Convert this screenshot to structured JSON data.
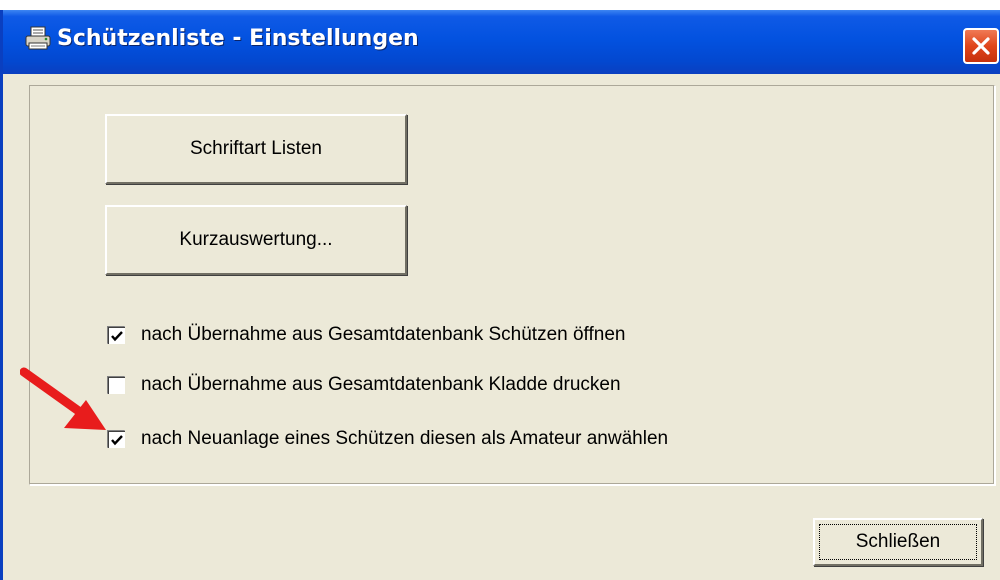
{
  "window": {
    "title": "Schützenliste - Einstellungen",
    "app_icon": "printer-icon",
    "close_icon": "close-icon"
  },
  "buttons": {
    "schriftart_label": "Schriftart Listen",
    "kurzauswertung_label": "Kurzauswertung...",
    "close_label": "Schließen"
  },
  "checkboxes": [
    {
      "label": "nach Übernahme aus Gesamtdatenbank Schützen öffnen",
      "checked": true
    },
    {
      "label": "nach Übernahme aus Gesamtdatenbank Kladde drucken",
      "checked": false
    },
    {
      "label": "nach Neuanlage eines Schützen diesen als Amateur anwählen",
      "checked": true
    }
  ],
  "annotation": {
    "icon": "red-arrow-icon",
    "color": "#e81c1c"
  },
  "colors": {
    "titlebar": "#0352e0",
    "dialog_bg": "#ece9d8",
    "close_button": "#e0451b"
  }
}
